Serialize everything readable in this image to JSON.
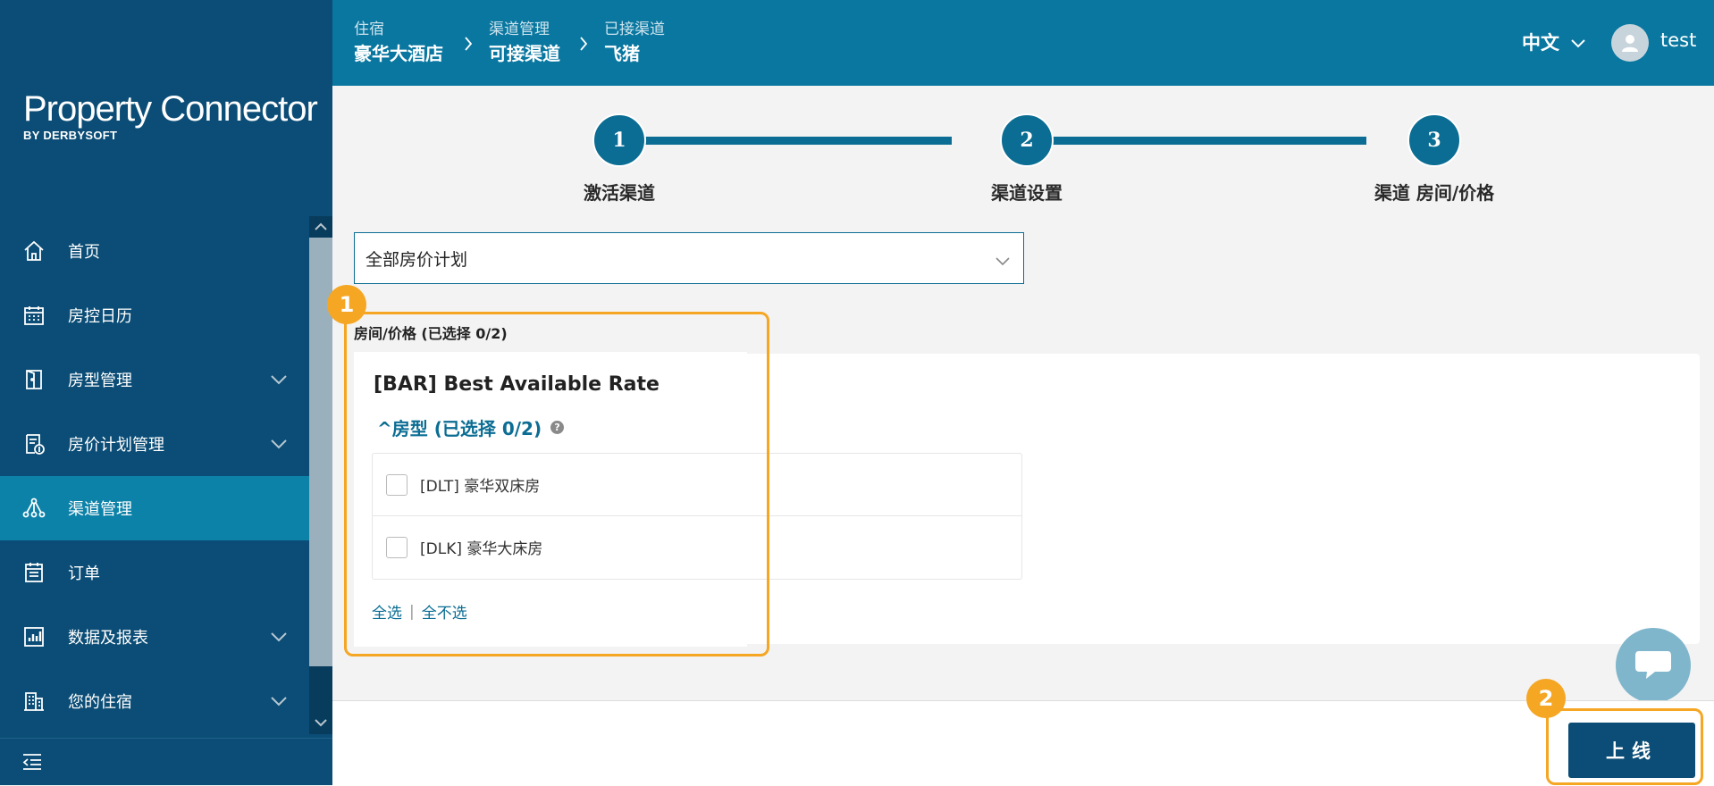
{
  "app": {
    "logo_main": "Property Connector",
    "logo_sub": "BY DERBYSOFT"
  },
  "sidebar": {
    "items": [
      {
        "label": "首页",
        "icon": "home-icon"
      },
      {
        "label": "房控日历",
        "icon": "calendar-icon"
      },
      {
        "label": "房型管理",
        "icon": "door-icon",
        "expandable": true
      },
      {
        "label": "房价计划管理",
        "icon": "rate-plan-icon",
        "expandable": true
      },
      {
        "label": "渠道管理",
        "icon": "channel-icon",
        "active": true
      },
      {
        "label": "订单",
        "icon": "order-icon"
      },
      {
        "label": "数据及报表",
        "icon": "report-icon",
        "expandable": true
      },
      {
        "label": "您的住宿",
        "icon": "building-icon",
        "expandable": true
      }
    ]
  },
  "header": {
    "breadcrumbs": [
      {
        "small": "住宿",
        "big": "豪华大酒店"
      },
      {
        "small": "渠道管理",
        "big": "可接渠道"
      },
      {
        "small": "已接渠道",
        "big": "飞猪"
      }
    ],
    "language": "中文",
    "user": "test"
  },
  "steps": [
    {
      "number": "1",
      "label": "激活渠道"
    },
    {
      "number": "2",
      "label": "渠道设置"
    },
    {
      "number": "3",
      "label": "渠道 房间/价格"
    }
  ],
  "filter": {
    "selected": "全部房价计划"
  },
  "rooms_section": {
    "title": "房间/价格 (已选择 0/2)",
    "rate_title": "[BAR] Best Available Rate",
    "room_type_toggle": "^房型 (已选择 0/2)",
    "help": "?",
    "rooms": [
      {
        "label": "[DLT] 豪华双床房",
        "checked": false
      },
      {
        "label": "[DLK] 豪华大床房",
        "checked": false
      }
    ],
    "select_all": "全选",
    "divider": "|",
    "select_none": "全不选"
  },
  "annotations": {
    "badge1": "1",
    "badge2": "2",
    "highlight_color": "#f5a623"
  },
  "footer": {
    "publish_label": "上线"
  },
  "colors": {
    "sidebar": "#0b4d76",
    "header": "#0977a0",
    "accent": "#0b6d93"
  }
}
